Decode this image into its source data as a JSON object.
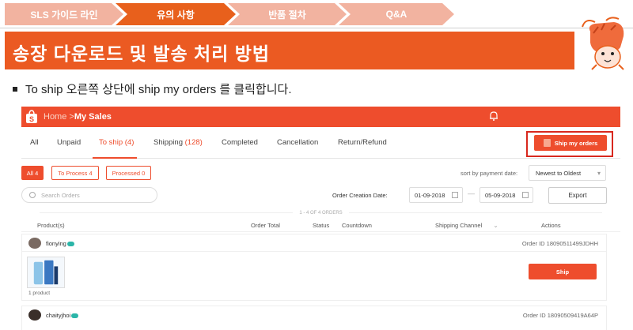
{
  "nav": {
    "items": [
      {
        "label": "SLS 가이드 라인"
      },
      {
        "label": "유의 사항"
      },
      {
        "label": "반품 절차"
      },
      {
        "label": "Q&A"
      }
    ],
    "active_index": 1
  },
  "title": "송장 다운로드 및 발송 처리 방법",
  "instruction": "To ship 오른쪽 상단에 ship my orders 를 클릭합니다.",
  "colors": {
    "accent": "#eb5a22",
    "shopee": "#ee4d2d",
    "highlight": "#d8281e"
  },
  "app": {
    "breadcrumb": {
      "home": "Home",
      "sep": ">",
      "current": "My Sales"
    },
    "tabs": [
      {
        "label": "All",
        "count": ""
      },
      {
        "label": "Unpaid",
        "count": ""
      },
      {
        "label": "To ship",
        "count": "(4)"
      },
      {
        "label": "Shipping",
        "count": "(128)"
      },
      {
        "label": "Completed",
        "count": ""
      },
      {
        "label": "Cancellation",
        "count": ""
      },
      {
        "label": "Return/Refund",
        "count": ""
      }
    ],
    "active_tab": "To ship",
    "ship_my_orders_label": "Ship my orders",
    "filters": [
      {
        "label": "All 4",
        "active": true
      },
      {
        "label": "To Process 4",
        "active": false
      },
      {
        "label": "Processed 0",
        "active": false
      }
    ],
    "sort_label": "sort by payment date:",
    "sort_value": "Newest to Oldest",
    "search_placeholder": "Search Orders",
    "date_label": "Order Creation Date:",
    "date_from": "01-09-2018",
    "date_to": "05-09-2018",
    "date_sep": "—",
    "export_label": "Export",
    "count_line": "1 - 4 OF 4 ORDERS",
    "columns": [
      "Product(s)",
      "Order Total",
      "Status",
      "Countdown",
      "Shipping Channel",
      "Actions"
    ],
    "orders": [
      {
        "user": "fionying",
        "order_id": "Order ID 18090511499JDHH",
        "product_count": "1 product",
        "action": "Ship"
      },
      {
        "user": "chaityjhoi",
        "order_id": "Order ID 18090509419A64P"
      }
    ]
  }
}
